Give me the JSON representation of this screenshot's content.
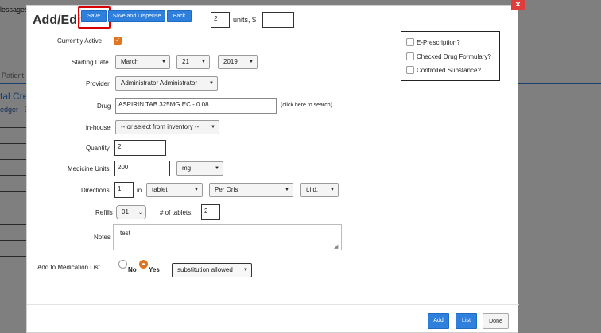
{
  "background": {
    "messages_label": "lessages",
    "patient_label": "Patient I",
    "credit_heading": "tal Cre",
    "ledger_link": "edger | E"
  },
  "modal": {
    "title": "Add/Edit",
    "close_glyph": "×",
    "toolbar": {
      "save_label": "Save",
      "save_dispense_label": "Save and Dispense",
      "back_label": "Back",
      "units_value": "2",
      "units_label": "units, $",
      "price_value": ""
    },
    "form": {
      "active_label": "Currently Active",
      "start_date_label": "Starting Date",
      "start_month": "March",
      "start_day": "21",
      "start_year": "2019",
      "provider_label": "Provider",
      "provider_value": "Administrator Administrator",
      "drug_label": "Drug",
      "drug_value": "ASPIRIN    TAB 325MG EC    - 0.08",
      "drug_hint": "(click here to search)",
      "inhouse_label": "in-house",
      "inhouse_value": "-- or select from inventory --",
      "quantity_label": "Quantity",
      "quantity_value": "2",
      "units_label": "Medicine Units",
      "units_value": "200",
      "units_unit": "mg",
      "directions_label": "Directions",
      "directions_value": "1",
      "directions_in": "in",
      "directions_form": "tablet",
      "directions_route": "Per Oris",
      "directions_freq": "t.i.d.",
      "refills_label": "Refills",
      "refills_value": "01",
      "tablets_label": "# of tablets:",
      "tablets_value": "2",
      "notes_label": "Notes",
      "notes_value": "test",
      "med_list_label": "Add to Medication List",
      "no_label": "No",
      "yes_label": "Yes",
      "substitution_value": "substitution allowed"
    },
    "side": {
      "eprescription": "E-Prescription?",
      "formulary": "Checked Drug Formulary?",
      "controlled": "Controlled Substance?"
    },
    "footer": {
      "add_label": "Add",
      "list_label": "List",
      "done_label": "Done"
    }
  },
  "colors": {
    "accent_blue": "#2f7fdc",
    "accent_orange": "#e0741f",
    "close_red": "#e03c3c",
    "highlight_red": "#d80000"
  }
}
